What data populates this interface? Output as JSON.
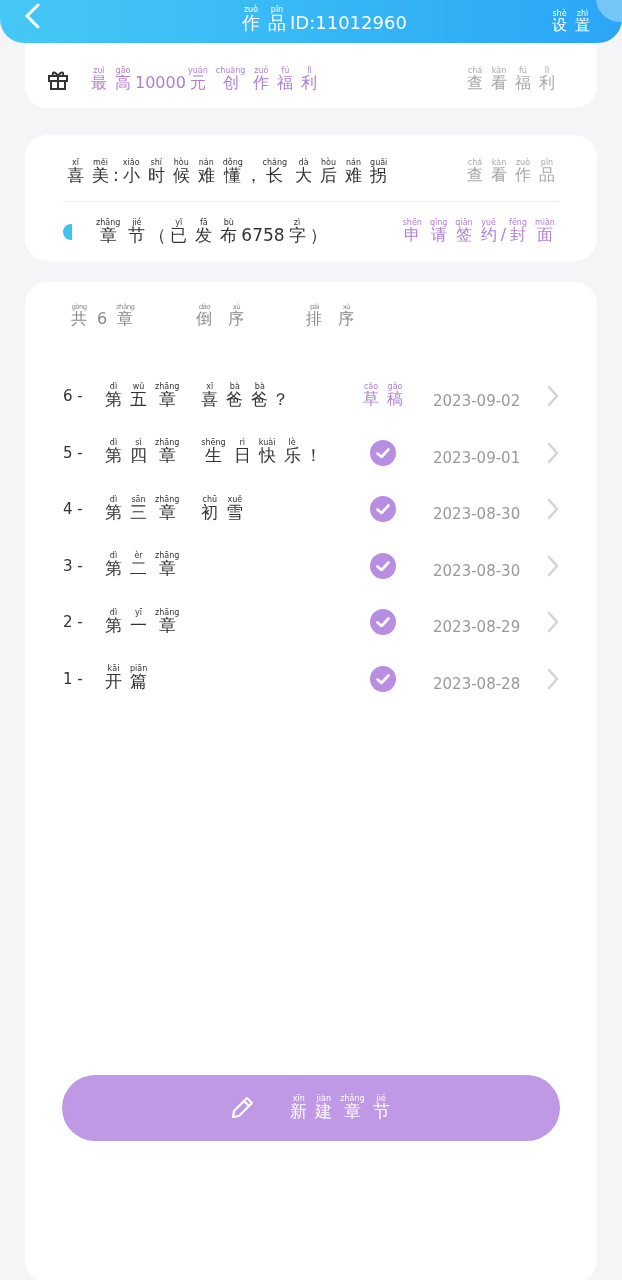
{
  "header": {
    "title": [
      {
        "c": "作",
        "py": "zuò"
      },
      {
        "c": "品",
        "py": "pǐn"
      },
      {
        "c": "ID:11012960"
      }
    ],
    "settings": [
      {
        "c": "设",
        "py": "shè"
      },
      {
        "c": "置",
        "py": "zhì"
      }
    ]
  },
  "benefit": {
    "text": [
      {
        "c": "最",
        "py": "zuì"
      },
      {
        "c": "高",
        "py": "gāo"
      },
      {
        "c": "10000"
      },
      {
        "c": "元",
        "py": "yuán"
      },
      {
        "c": "创",
        "py": "chuàng"
      },
      {
        "c": "作",
        "py": "zuò"
      },
      {
        "c": "福",
        "py": "fú"
      },
      {
        "c": "利",
        "py": "lì"
      }
    ],
    "link": [
      {
        "c": "查",
        "py": "chá"
      },
      {
        "c": "看",
        "py": "kàn"
      },
      {
        "c": "福",
        "py": "fú"
      },
      {
        "c": "利",
        "py": "lì"
      }
    ]
  },
  "work": {
    "title": [
      {
        "c": "喜",
        "py": "xǐ"
      },
      {
        "c": "美",
        "py": "měi"
      },
      {
        "c": ":"
      },
      {
        "c": "小",
        "py": "xiǎo"
      },
      {
        "c": "时",
        "py": "shí"
      },
      {
        "c": "候",
        "py": "hòu"
      },
      {
        "c": "难",
        "py": "nán"
      },
      {
        "c": "懂",
        "py": "dǒng"
      },
      {
        "c": "，"
      },
      {
        "c": "长",
        "py": "cháng"
      },
      {
        "c": "大",
        "py": "dà"
      },
      {
        "c": "后",
        "py": "hòu"
      },
      {
        "c": "难",
        "py": "nán"
      },
      {
        "c": "拐",
        "py": "guǎi"
      }
    ],
    "view": [
      {
        "c": "查",
        "py": "chá"
      },
      {
        "c": "看",
        "py": "kàn"
      },
      {
        "c": "作",
        "py": "zuò"
      },
      {
        "c": "品",
        "py": "pǐn"
      }
    ],
    "chapters_label": [
      {
        "c": "章",
        "py": "zhāng"
      },
      {
        "c": "节",
        "py": "jié"
      },
      {
        "c": "（"
      },
      {
        "c": "已",
        "py": "yǐ"
      },
      {
        "c": "发",
        "py": "fā"
      },
      {
        "c": "布",
        "py": "bù"
      },
      {
        "c": "6758"
      },
      {
        "c": "字",
        "py": "zì"
      },
      {
        "c": "）"
      }
    ],
    "apply": [
      {
        "c": "申",
        "py": "shēn"
      },
      {
        "c": "请",
        "py": "qǐng"
      },
      {
        "c": "签",
        "py": "qiān"
      },
      {
        "c": "约",
        "py": "yuē"
      },
      {
        "c": "/"
      },
      {
        "c": "封",
        "py": "fēng"
      },
      {
        "c": "面",
        "py": "miàn"
      }
    ]
  },
  "list": {
    "count": [
      {
        "c": "共",
        "py": "gòng"
      },
      {
        "c": "6"
      },
      {
        "c": "章",
        "py": "zhāng"
      }
    ],
    "sort_options": [
      [
        {
          "c": "倒",
          "py": "dào"
        },
        {
          "c": "序",
          "py": "xù"
        }
      ],
      [
        {
          "c": "排",
          "py": "pái"
        },
        {
          "c": "序",
          "py": "xù"
        }
      ]
    ],
    "chapters": [
      {
        "number": "6 -",
        "title": [
          {
            "c": "第",
            "py": "dì"
          },
          {
            "c": "五",
            "py": "wǔ"
          },
          {
            "c": "章",
            "py": "zhāng"
          }
        ],
        "name": [
          {
            "c": "喜",
            "py": "xǐ"
          },
          {
            "c": "爸",
            "py": "bà"
          },
          {
            "c": "爸",
            "py": "bà"
          },
          {
            "c": "？"
          }
        ],
        "status": {
          "kind": "draft",
          "label": [
            {
              "c": "草",
              "py": "cǎo"
            },
            {
              "c": "稿",
              "py": "gǎo"
            }
          ]
        },
        "date": "2023-09-02"
      },
      {
        "number": "5 -",
        "title": [
          {
            "c": "第",
            "py": "dì"
          },
          {
            "c": "四",
            "py": "sì"
          },
          {
            "c": "章",
            "py": "zhāng"
          }
        ],
        "name": [
          {
            "c": "生",
            "py": "shēng"
          },
          {
            "c": "日",
            "py": "rì"
          },
          {
            "c": "快",
            "py": "kuài"
          },
          {
            "c": "乐",
            "py": "lè"
          },
          {
            "c": "！"
          }
        ],
        "status": {
          "kind": "published"
        },
        "date": "2023-09-01"
      },
      {
        "number": "4 -",
        "title": [
          {
            "c": "第",
            "py": "dì"
          },
          {
            "c": "三",
            "py": "sān"
          },
          {
            "c": "章",
            "py": "zhāng"
          }
        ],
        "name": [
          {
            "c": "初",
            "py": "chū"
          },
          {
            "c": "雪",
            "py": "xuě"
          }
        ],
        "status": {
          "kind": "published"
        },
        "date": "2023-08-30"
      },
      {
        "number": "3 -",
        "title": [
          {
            "c": "第",
            "py": "dì"
          },
          {
            "c": "二",
            "py": "èr"
          },
          {
            "c": "章",
            "py": "zhāng"
          }
        ],
        "status": {
          "kind": "published"
        },
        "date": "2023-08-30"
      },
      {
        "number": "2 -",
        "title": [
          {
            "c": "第",
            "py": "dì"
          },
          {
            "c": "一",
            "py": "yī"
          },
          {
            "c": "章",
            "py": "zhāng"
          }
        ],
        "status": {
          "kind": "published"
        },
        "date": "2023-08-29"
      },
      {
        "number": "1 -",
        "title": [
          {
            "c": "开",
            "py": "kāi"
          },
          {
            "c": "篇",
            "py": "piān"
          }
        ],
        "status": {
          "kind": "published"
        },
        "date": "2023-08-28"
      }
    ]
  },
  "new_chapter_button": [
    {
      "c": "新",
      "py": "xīn"
    },
    {
      "c": "建",
      "py": "jiàn"
    },
    {
      "c": "章",
      "py": "zhāng"
    },
    {
      "c": "节",
      "py": "jié"
    }
  ]
}
